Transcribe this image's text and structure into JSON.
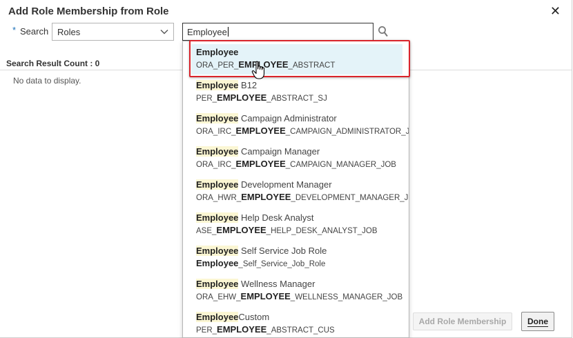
{
  "dialog": {
    "title": "Add Role Membership from Role",
    "close_glyph": "✕"
  },
  "search": {
    "required_marker": "*",
    "label": "Search",
    "category_value": "Roles",
    "query_value": "Employee"
  },
  "results": {
    "count_label": "Search Result Count : 0",
    "empty_message": "No data to display."
  },
  "buttons": {
    "add_membership": "Add Role Membership",
    "done": "Done"
  },
  "suggestions": [
    {
      "name_match": "Employee",
      "name_rest": "",
      "code_pre": "ORA_PER_",
      "code_match": "EMPLOYEE",
      "code_post": "_ABSTRACT",
      "selected": true
    },
    {
      "name_match": "Employee",
      "name_rest": " B12",
      "code_pre": "PER_",
      "code_match": "EMPLOYEE",
      "code_post": "_ABSTRACT_SJ"
    },
    {
      "name_match": "Employee",
      "name_rest": " Campaign Administrator",
      "code_pre": "ORA_IRC_",
      "code_match": "EMPLOYEE",
      "code_post": "_CAMPAIGN_ADMINISTRATOR_JOB"
    },
    {
      "name_match": "Employee",
      "name_rest": " Campaign Manager",
      "code_pre": "ORA_IRC_",
      "code_match": "EMPLOYEE",
      "code_post": "_CAMPAIGN_MANAGER_JOB"
    },
    {
      "name_match": "Employee",
      "name_rest": " Development Manager",
      "code_pre": "ORA_HWR_",
      "code_match": "EMPLOYEE",
      "code_post": "_DEVELOPMENT_MANAGER_JOB"
    },
    {
      "name_match": "Employee",
      "name_rest": " Help Desk Analyst",
      "code_pre": "ASE_",
      "code_match": "EMPLOYEE",
      "code_post": "_HELP_DESK_ANALYST_JOB"
    },
    {
      "name_match": "Employee",
      "name_rest": " Self Service Job Role",
      "code_pre": "",
      "code_match": "Employee",
      "code_post": "_Self_Service_Job_Role"
    },
    {
      "name_match": "Employee",
      "name_rest": " Wellness Manager",
      "code_pre": "ORA_EHW_",
      "code_match": "EMPLOYEE",
      "code_post": "_WELLNESS_MANAGER_JOB"
    },
    {
      "name_match": "Employee",
      "name_rest": "Custom",
      "code_pre": "PER_",
      "code_match": "EMPLOYEE",
      "code_post": "_ABSTRACT_CUS"
    }
  ],
  "icons": {
    "search": "magnifier-icon",
    "dropdown": "chevron-down-icon",
    "close": "close-icon",
    "cursor": "hand-pointer-icon"
  },
  "colors": {
    "highlight_row": "#e4f3f9",
    "match_highlight": "#fbf6d3",
    "annotation_border": "#d9232b",
    "required_marker": "#1a6fb8"
  }
}
